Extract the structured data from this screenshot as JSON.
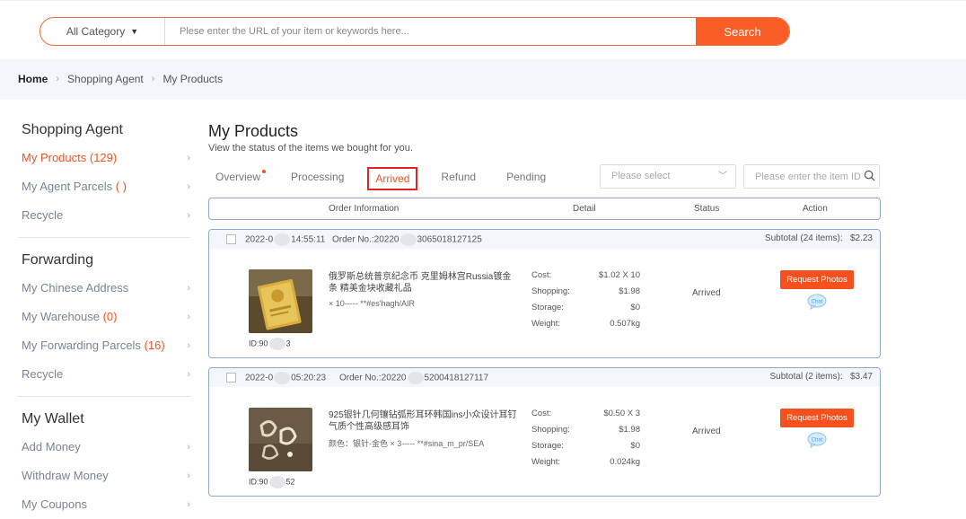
{
  "search": {
    "category_label": "All Category",
    "placeholder": "Plese enter the URL of your item or keywords here...",
    "button_label": "Search"
  },
  "breadcrumb": {
    "items": [
      "Home",
      "Shopping Agent",
      "My Products"
    ]
  },
  "sidebar": {
    "groups": [
      {
        "title": "Shopping Agent",
        "items": [
          {
            "label": "My Products",
            "count": "(129)"
          },
          {
            "label": "My Agent Parcels",
            "count": "(  )"
          },
          {
            "label": "Recycle",
            "count": ""
          }
        ]
      },
      {
        "title": "Forwarding",
        "items": [
          {
            "label": "My Chinese Address",
            "count": ""
          },
          {
            "label": "My Warehouse",
            "count": "(0)"
          },
          {
            "label": "My Forwarding Parcels",
            "count": "(16)"
          },
          {
            "label": "Recycle",
            "count": ""
          }
        ]
      },
      {
        "title": "My Wallet",
        "items": [
          {
            "label": "Add Money",
            "count": ""
          },
          {
            "label": "Withdraw Money",
            "count": ""
          },
          {
            "label": "My Coupons",
            "count": ""
          }
        ]
      }
    ]
  },
  "main": {
    "title": "My Products",
    "subtitle": "View the status of the items we bought for you.",
    "tabs": [
      "Overview",
      "Processing",
      "Arrived",
      "Refund",
      "Pending"
    ],
    "selected_tab": "Arrived",
    "filter_select_placeholder": "Please select",
    "filter_search_placeholder": "Please enter the item ID",
    "table_headers": [
      "Order Information",
      "Detail",
      "Status",
      "Action"
    ]
  },
  "orders": [
    {
      "date_prefix": "2022-0",
      "date_suffix": "14:55:11",
      "order_prefix": "Order No.:20220",
      "order_suffix": "3065018127125",
      "subtotal_label": "Subtotal (24 items):",
      "subtotal_value": "$2.23",
      "product_name": "俄罗斯总统普京纪念币 克里姆林宫Russia镀金条 精美金块收藏礼品",
      "product_spec": "× 10----- **#es'hagh/AIR",
      "id_prefix": "ID:90",
      "id_suffix": "3",
      "cost_rows": [
        {
          "label": "Cost:",
          "value": "$1.02 X 10"
        },
        {
          "label": "Shopping:",
          "value": "$1.98"
        },
        {
          "label": "Storage:",
          "value": "$0"
        },
        {
          "label": "Weight:",
          "value": "0.507kg"
        }
      ],
      "status": "Arrived",
      "action_label": "Request Photos",
      "chat_label": "Chat"
    },
    {
      "date_prefix": "2022-0",
      "date_suffix": "05:20:23",
      "order_prefix": "Order No.:20220",
      "order_suffix": "5200418127117",
      "subtotal_label": "Subtotal (2 items):",
      "subtotal_value": "$3.47",
      "product_name": "925银针几何镶钻弧形耳环韩国ins小众设计耳钉 气质个性高级感耳饰",
      "product_spec": "颜色：银针-金色 × 3----- **#sina_m_pr/SEA",
      "id_prefix": "ID:90",
      "id_suffix": "52",
      "cost_rows": [
        {
          "label": "Cost:",
          "value": "$0.50 X 3"
        },
        {
          "label": "Shopping:",
          "value": "$1.98"
        },
        {
          "label": "Storage:",
          "value": "$0"
        },
        {
          "label": "Weight:",
          "value": "0.024kg"
        }
      ],
      "status": "Arrived",
      "action_label": "Request Photos",
      "chat_label": "Chat"
    }
  ],
  "colors": {
    "accent": "#fb5d27",
    "active_text": "#f05323",
    "border_blue": "#8fa9cc",
    "tab_highlight": "#e02424"
  }
}
